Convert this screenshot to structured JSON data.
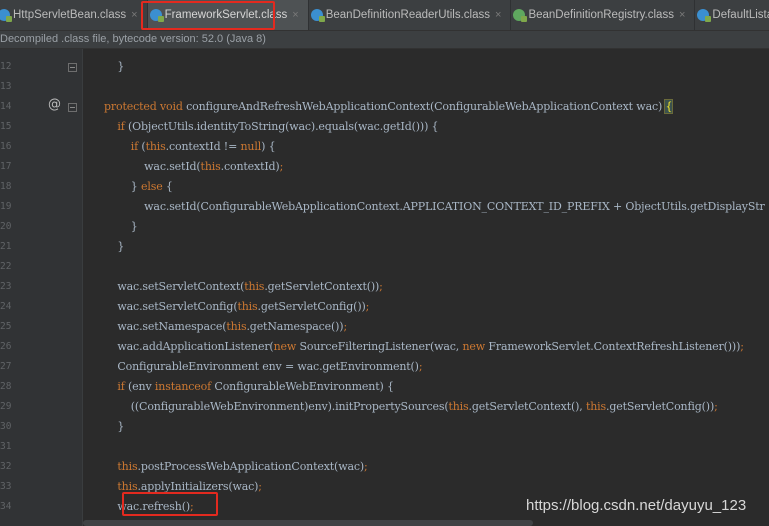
{
  "tabs": [
    {
      "label": "HttpServletBean.class",
      "icon": "class-file-icon",
      "active": false
    },
    {
      "label": "FrameworkServlet.class",
      "icon": "class-file-icon",
      "active": true
    },
    {
      "label": "BeanDefinitionReaderUtils.class",
      "icon": "class-file-icon",
      "active": false
    },
    {
      "label": "BeanDefinitionRegistry.class",
      "icon": "interface-file-icon",
      "active": false
    },
    {
      "label": "DefaultListableBea",
      "icon": "class-file-icon",
      "active": false
    }
  ],
  "tab_close_glyph": "×",
  "info_bar": "Decompiled .class file, bytecode version: 52.0 (Java 8)",
  "line_numbers": [
    "12",
    "13",
    "14",
    "15",
    "16",
    "17",
    "18",
    "19",
    "20",
    "21",
    "22",
    "23",
    "24",
    "25",
    "26",
    "27",
    "28",
    "29",
    "30",
    "31",
    "32",
    "33",
    "34"
  ],
  "gutter_annotation": "@",
  "code_lines": [
    [
      {
        "t": "    }"
      }
    ],
    [
      {
        "t": ""
      }
    ],
    [
      {
        "t": "protected void ",
        "k": 1
      },
      {
        "t": "configureAndRefreshWebApplicationContext(ConfigurableWebApplicationContext wac) "
      },
      {
        "t": "{",
        "c": 1
      }
    ],
    [
      {
        "t": "    "
      },
      {
        "t": "if",
        "k": 1
      },
      {
        "t": " (ObjectUtils.identityToString(wac).equals(wac.getId())) {"
      }
    ],
    [
      {
        "t": "        "
      },
      {
        "t": "if",
        "k": 1
      },
      {
        "t": " ("
      },
      {
        "t": "this",
        "k": 1
      },
      {
        "t": ".contextId != "
      },
      {
        "t": "null",
        "k": 1
      },
      {
        "t": ") {"
      }
    ],
    [
      {
        "t": "            wac.setId("
      },
      {
        "t": "this",
        "k": 1
      },
      {
        "t": ".contextId)"
      },
      {
        "t": ";",
        "k": 1
      }
    ],
    [
      {
        "t": "        } "
      },
      {
        "t": "else",
        "k": 1
      },
      {
        "t": " {"
      }
    ],
    [
      {
        "t": "            wac.setId(ConfigurableWebApplicationContext.APPLICATION_CONTEXT_ID_PREFIX + ObjectUtils.getDisplayStr"
      }
    ],
    [
      {
        "t": "        }"
      }
    ],
    [
      {
        "t": "    }"
      }
    ],
    [
      {
        "t": ""
      }
    ],
    [
      {
        "t": "    wac.setServletContext("
      },
      {
        "t": "this",
        "k": 1
      },
      {
        "t": ".getServletContext())"
      },
      {
        "t": ";",
        "k": 1
      }
    ],
    [
      {
        "t": "    wac.setServletConfig("
      },
      {
        "t": "this",
        "k": 1
      },
      {
        "t": ".getServletConfig())"
      },
      {
        "t": ";",
        "k": 1
      }
    ],
    [
      {
        "t": "    wac.setNamespace("
      },
      {
        "t": "this",
        "k": 1
      },
      {
        "t": ".getNamespace())"
      },
      {
        "t": ";",
        "k": 1
      }
    ],
    [
      {
        "t": "    wac.addApplicationListener("
      },
      {
        "t": "new",
        "k": 1
      },
      {
        "t": " SourceFilteringListener(wac, "
      },
      {
        "t": "new",
        "k": 1
      },
      {
        "t": " FrameworkServlet.ContextRefreshListener()))"
      },
      {
        "t": ";",
        "k": 1
      }
    ],
    [
      {
        "t": "    ConfigurableEnvironment env = wac.getEnvironment()"
      },
      {
        "t": ";",
        "k": 1
      }
    ],
    [
      {
        "t": "    "
      },
      {
        "t": "if",
        "k": 1
      },
      {
        "t": " (env "
      },
      {
        "t": "instanceof",
        "k": 1
      },
      {
        "t": " ConfigurableWebEnvironment) {"
      }
    ],
    [
      {
        "t": "        ((ConfigurableWebEnvironment)env).initPropertySources("
      },
      {
        "t": "this",
        "k": 1
      },
      {
        "t": ".getServletContext(), "
      },
      {
        "t": "this",
        "k": 1
      },
      {
        "t": ".getServletConfig())"
      },
      {
        "t": ";",
        "k": 1
      }
    ],
    [
      {
        "t": "    }"
      }
    ],
    [
      {
        "t": ""
      }
    ],
    [
      {
        "t": "    "
      },
      {
        "t": "this",
        "k": 1
      },
      {
        "t": ".postProcessWebApplicationContext(wac)"
      },
      {
        "t": ";",
        "k": 1
      }
    ],
    [
      {
        "t": "    "
      },
      {
        "t": "this",
        "k": 1
      },
      {
        "t": ".applyInitializers(wac)"
      },
      {
        "t": ";",
        "k": 1
      }
    ],
    [
      {
        "t": "    wac.refresh()"
      },
      {
        "t": ";",
        "k": 1
      }
    ]
  ],
  "watermark": "https://blog.csdn.net/dayuyu_123",
  "colors": {
    "keyword": "#cc7832",
    "text": "#a9b7c6",
    "highlight_box": "#e32a1f",
    "background": "#2b2b2b"
  }
}
